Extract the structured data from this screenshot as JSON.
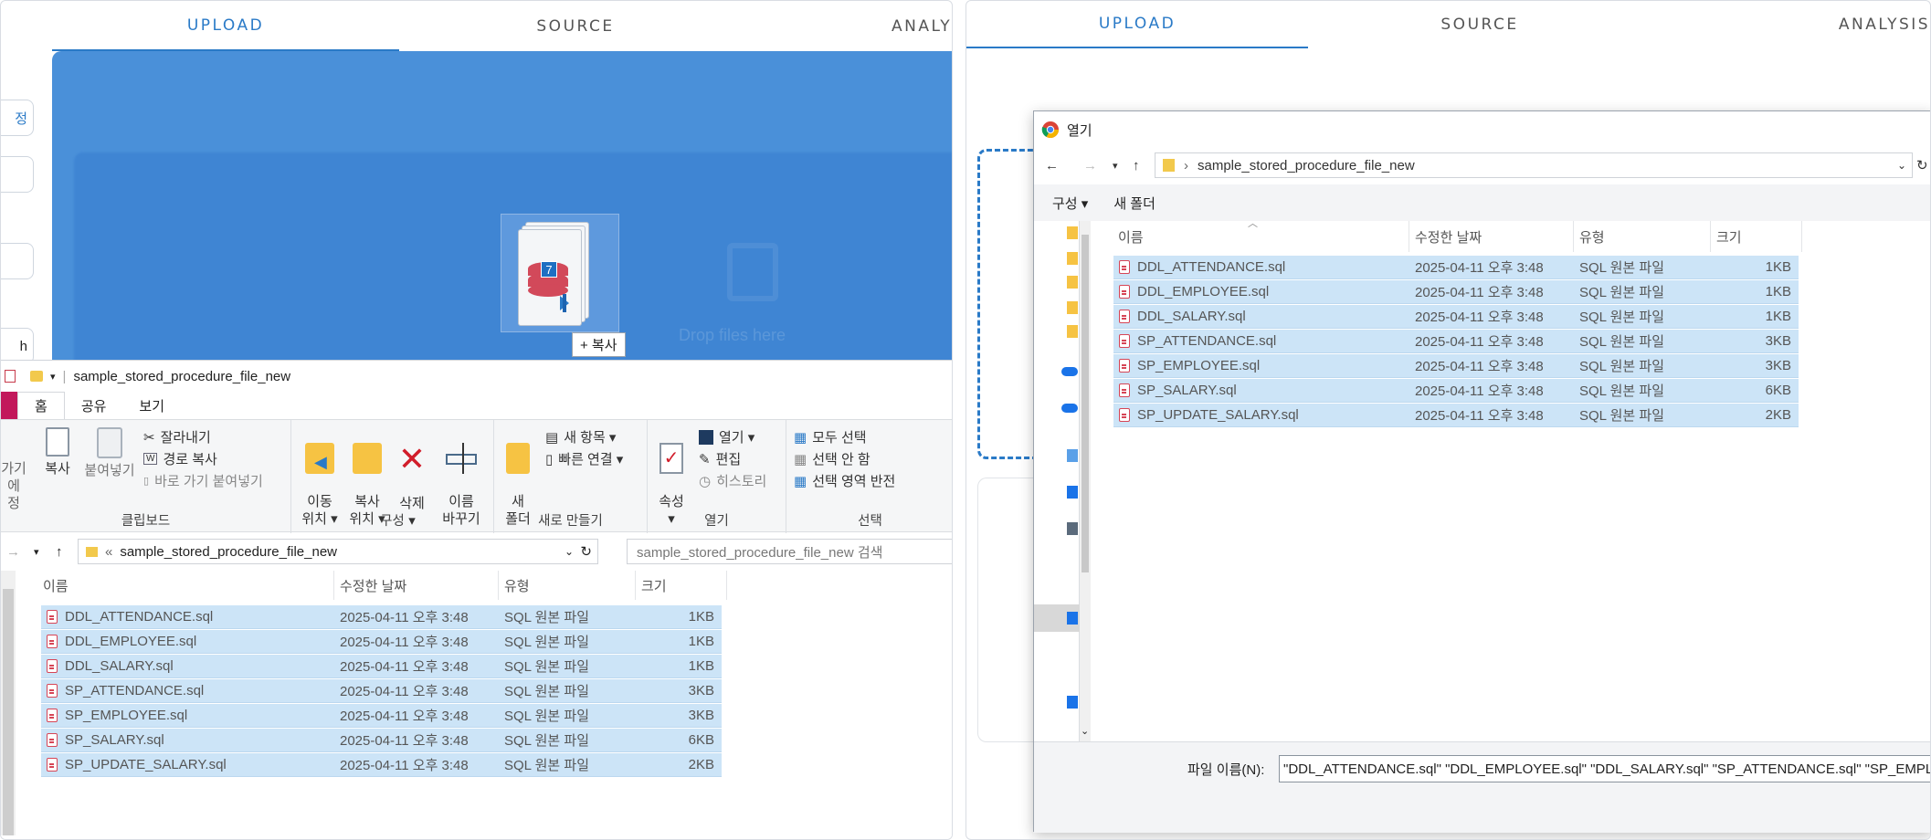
{
  "left_panel": {
    "tabs": [
      {
        "label": "UPLOAD",
        "active": true
      },
      {
        "label": "SOURCE",
        "active": false
      },
      {
        "label": "ANALYS",
        "active": false
      }
    ],
    "side_buttons": [
      "정",
      "",
      "",
      "h"
    ],
    "drop_ghost_text": "Drop files here",
    "drag_badge_number": "7",
    "copy_tooltip": "+ 복사",
    "explorer": {
      "title": "sample_stored_procedure_file_new",
      "ribbon_tabs": [
        "홈",
        "공유",
        "보기"
      ],
      "clipboard": {
        "pin_label": "가기에\n정",
        "copy": "복사",
        "paste": "붙여넣기",
        "cut": "잘라내기",
        "copy_path": "경로 복사",
        "paste_shortcut": "바로 가기 붙여넣기",
        "group_label": "클립보드"
      },
      "organize": {
        "move_to": "이동\n위치 ▾",
        "copy_to": "복사\n위치 ▾",
        "delete": "삭제\n▾",
        "rename": "이름\n바꾸기",
        "group_label": "구성"
      },
      "new": {
        "new_folder": "새\n폴더",
        "new_item": "새 항목 ▾",
        "easy_access": "빠른 연결 ▾",
        "group_label": "새로 만들기"
      },
      "open": {
        "properties": "속성\n▾",
        "open": "열기 ▾",
        "edit": "편집",
        "history": "히스토리",
        "group_label": "열기"
      },
      "select": {
        "select_all": "모두 선택",
        "select_none": "선택 안 함",
        "invert": "선택 영역 반전",
        "group_label": "선택"
      },
      "address": "sample_stored_procedure_file_new",
      "search_placeholder": "sample_stored_procedure_file_new 검색",
      "columns": [
        "이름",
        "수정한 날짜",
        "유형",
        "크기"
      ],
      "files": [
        {
          "name": "DDL_ATTENDANCE.sql",
          "date": "2025-04-11 오후 3:48",
          "type": "SQL 원본 파일",
          "size": "1KB"
        },
        {
          "name": "DDL_EMPLOYEE.sql",
          "date": "2025-04-11 오후 3:48",
          "type": "SQL 원본 파일",
          "size": "1KB"
        },
        {
          "name": "DDL_SALARY.sql",
          "date": "2025-04-11 오후 3:48",
          "type": "SQL 원본 파일",
          "size": "1KB"
        },
        {
          "name": "SP_ATTENDANCE.sql",
          "date": "2025-04-11 오후 3:48",
          "type": "SQL 원본 파일",
          "size": "3KB"
        },
        {
          "name": "SP_EMPLOYEE.sql",
          "date": "2025-04-11 오후 3:48",
          "type": "SQL 원본 파일",
          "size": "3KB"
        },
        {
          "name": "SP_SALARY.sql",
          "date": "2025-04-11 오후 3:48",
          "type": "SQL 원본 파일",
          "size": "6KB"
        },
        {
          "name": "SP_UPDATE_SALARY.sql",
          "date": "2025-04-11 오후 3:48",
          "type": "SQL 원본 파일",
          "size": "2KB"
        }
      ]
    }
  },
  "right_panel": {
    "tabs": [
      {
        "label": "UPLOAD",
        "active": true
      },
      {
        "label": "SOURCE",
        "active": false
      },
      {
        "label": "ANALYSIS",
        "active": false
      }
    ],
    "dialog": {
      "title": "열기",
      "address": "sample_stored_procedure_file_new",
      "toolbar": {
        "organize": "구성 ▾",
        "new_folder": "새 폴더"
      },
      "columns": [
        "이름",
        "수정한 날짜",
        "유형",
        "크기"
      ],
      "files": [
        {
          "name": "DDL_ATTENDANCE.sql",
          "date": "2025-04-11 오후 3:48",
          "type": "SQL 원본 파일",
          "size": "1KB"
        },
        {
          "name": "DDL_EMPLOYEE.sql",
          "date": "2025-04-11 오후 3:48",
          "type": "SQL 원본 파일",
          "size": "1KB"
        },
        {
          "name": "DDL_SALARY.sql",
          "date": "2025-04-11 오후 3:48",
          "type": "SQL 원본 파일",
          "size": "1KB"
        },
        {
          "name": "SP_ATTENDANCE.sql",
          "date": "2025-04-11 오후 3:48",
          "type": "SQL 원본 파일",
          "size": "3KB"
        },
        {
          "name": "SP_EMPLOYEE.sql",
          "date": "2025-04-11 오후 3:48",
          "type": "SQL 원본 파일",
          "size": "3KB"
        },
        {
          "name": "SP_SALARY.sql",
          "date": "2025-04-11 오후 3:48",
          "type": "SQL 원본 파일",
          "size": "6KB"
        },
        {
          "name": "SP_UPDATE_SALARY.sql",
          "date": "2025-04-11 오후 3:48",
          "type": "SQL 원본 파일",
          "size": "2KB"
        }
      ],
      "filename_label": "파일 이름(N):",
      "filename_value": "\"DDL_ATTENDANCE.sql\" \"DDL_EMPLOYEE.sql\" \"DDL_SALARY.sql\" \"SP_ATTENDANCE.sql\" \"SP_EMPLOYEE"
    }
  },
  "colors": {
    "accent": "#2a7ac7",
    "selection": "#cce4f7",
    "drop_blue": "#4a90d9"
  }
}
